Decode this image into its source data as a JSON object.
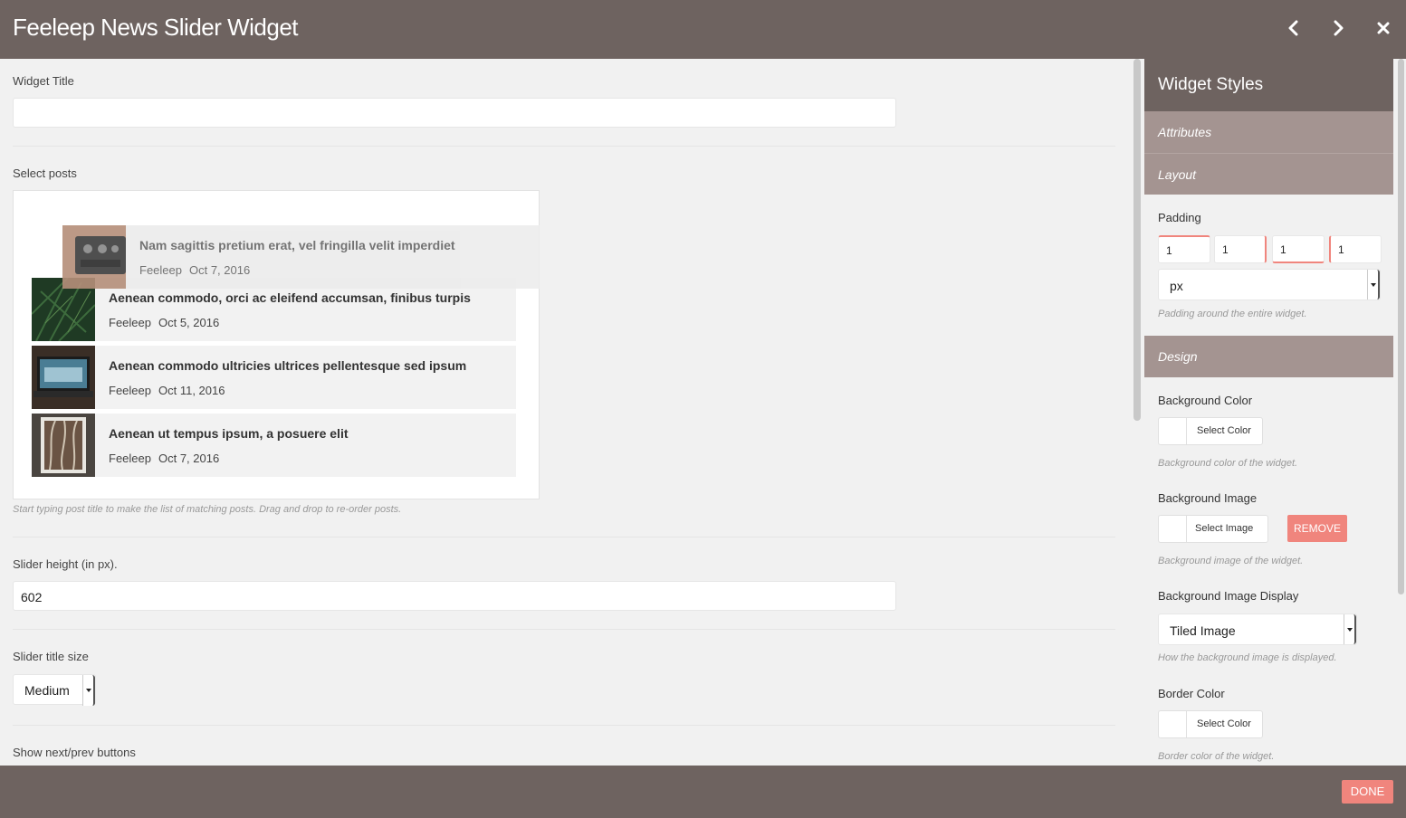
{
  "header": {
    "title": "Feeleep News Slider Widget",
    "prev_icon": "chevron-left-icon",
    "next_icon": "chevron-right-icon",
    "close_icon": "close-icon"
  },
  "form": {
    "widget_title_label": "Widget Title",
    "widget_title_value": "",
    "select_posts_label": "Select posts",
    "posts": [
      {
        "title": "Nam sagittis pretium erat, vel fringilla velit imperdiet",
        "author": "Feeleep",
        "date": "Oct 7, 2016",
        "thumb": "amplifier-photo"
      },
      {
        "title": "Aenean commodo, orci ac eleifend accumsan, finibus turpis",
        "author": "Feeleep",
        "date": "Oct 5, 2016",
        "thumb": "pine-branches-photo"
      },
      {
        "title": "Aenean commodo ultricies ultrices pellentesque sed ipsum",
        "author": "Feeleep",
        "date": "Oct 11, 2016",
        "thumb": "laptop-photo"
      },
      {
        "title": "Aenean ut tempus ipsum, a posuere elit",
        "author": "Feeleep",
        "date": "Oct 7, 2016",
        "thumb": "branches-frame-photo"
      }
    ],
    "posts_help": "Start typing post title to make the list of matching posts. Drag and drop to re-order posts.",
    "slider_height_label": "Slider height (in px).",
    "slider_height_value": "602",
    "title_size_label": "Slider title size",
    "title_size_value": "Medium",
    "show_buttons_label": "Show next/prev buttons"
  },
  "styles": {
    "title": "Widget Styles",
    "sections": {
      "attributes": "Attributes",
      "layout": "Layout",
      "design": "Design"
    },
    "padding_label": "Padding",
    "padding_values": [
      "1",
      "1",
      "1",
      "1"
    ],
    "padding_unit": "px",
    "padding_help": "Padding around the entire widget.",
    "bg_color_label": "Background Color",
    "bg_color_button": "Select Color",
    "bg_color_help": "Background color of the widget.",
    "bg_image_label": "Background Image",
    "bg_image_button": "Select Image",
    "bg_image_remove": "REMOVE",
    "bg_image_help": "Background image of the widget.",
    "bg_display_label": "Background Image Display",
    "bg_display_value": "Tiled Image",
    "bg_display_help": "How the background image is displayed.",
    "border_color_label": "Border Color",
    "border_color_button": "Select Color",
    "border_color_help": "Border color of the widget."
  },
  "footer": {
    "done_label": "DONE"
  },
  "colors": {
    "header_bg": "#6e6360",
    "section_bg": "#a49491",
    "accent": "#f0857d",
    "body_bg": "#f1f1f1"
  }
}
